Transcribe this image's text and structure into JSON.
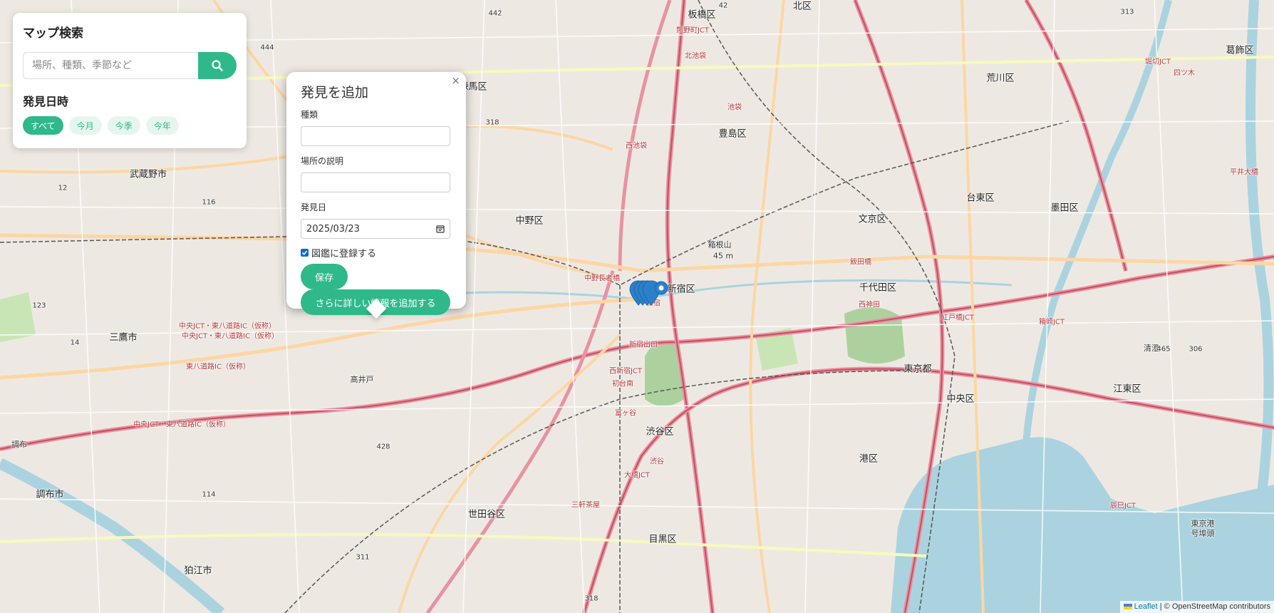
{
  "search": {
    "title": "マップ検索",
    "placeholder": "場所、種類、季節など",
    "date_heading": "発見日時",
    "filters": [
      {
        "label": "すべて",
        "active": true
      },
      {
        "label": "今月",
        "active": false
      },
      {
        "label": "今季",
        "active": false
      },
      {
        "label": "今年",
        "active": false
      }
    ]
  },
  "popup": {
    "title": "発見を追加",
    "close": "×",
    "type_label": "種類",
    "type_value": "",
    "place_label": "場所の説明",
    "place_value": "",
    "date_label": "発見日",
    "date_value": "2025/03/23",
    "register_label": "図鑑に登録する",
    "register_checked": true,
    "save_label": "保存",
    "more_label": "さらに詳しい情報を追加する"
  },
  "map": {
    "labels": {
      "ward": [
        "板橋区",
        "北区",
        "荒川区",
        "葛飾区",
        "練馬区",
        "豊島区",
        "武蔵野市",
        "中野区",
        "文京区",
        "台東区",
        "墨田区",
        "新宿区",
        "千代田区",
        "三鷹市",
        "東京都",
        "中央区",
        "江東区",
        "渋谷区",
        "港区",
        "世田谷区",
        "調布市",
        "目黒区",
        "狛江市"
      ],
      "road": [
        "中央JCT・東八道路IC（仮称）",
        "中央JCT・東八道路IC（仮称）",
        "中央JCT・東八道路IC（仮称）",
        "東八道路IC（仮称）",
        "中野長者橋",
        "新宿出口",
        "西新宿JCT",
        "初台南",
        "富ヶ谷",
        "渋谷",
        "大橋JCT",
        "三軒茶屋",
        "池袋",
        "北池袋",
        "西池袋",
        "熊野町JCT",
        "新宿",
        "飯田橋",
        "西神田",
        "江戸橋JCT",
        "箱崎JCT",
        "辰巳JCT",
        "堀切JCT",
        "四ツ木",
        "平井大橋"
      ],
      "other": [
        "箱根山",
        "45 m",
        "高井戸",
        "調布",
        "東京港",
        "号埠頭",
        "清澄"
      ],
      "numbers": [
        "442",
        "444",
        "318",
        "12",
        "116",
        "123",
        "14",
        "428",
        "311",
        "114",
        "318",
        "465",
        "306",
        "313",
        "42"
      ]
    },
    "markers": {
      "count": 4,
      "color": "#2a81cb"
    }
  },
  "attribution": {
    "leaflet": "Leaflet",
    "separator": " | ",
    "osm": "© OpenStreetMap contributors"
  }
}
